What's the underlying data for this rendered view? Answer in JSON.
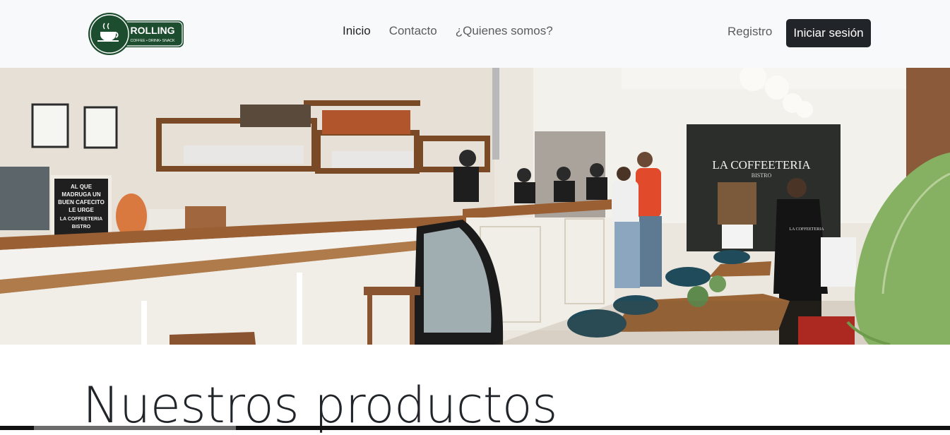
{
  "brand": {
    "name": "ROLLING",
    "tagline": "COFFEE • DRINK• SNACK"
  },
  "nav": {
    "items": [
      {
        "label": "Inicio",
        "active": true
      },
      {
        "label": "Contacto",
        "active": false
      },
      {
        "label": "¿Quienes somos?",
        "active": false
      }
    ],
    "register_label": "Registro",
    "login_label": "Iniciar sesión"
  },
  "hero": {
    "sign_wall": "LA COFFEETERIA",
    "sign_wall_sub": "BISTRO",
    "chalkboard_lines": [
      "AL QUE",
      "MADRUGA UN",
      "BUEN CAFECITO",
      "LE URGE",
      "LA COFFEETERIA",
      "BISTRO"
    ],
    "shirt_text": "LA COFFEETERIA"
  },
  "main": {
    "title": "Nuestros productos"
  },
  "colors": {
    "brand_green": "#1d4d2f",
    "login_bg": "#212529",
    "navbar_bg": "#f8f9fa"
  }
}
